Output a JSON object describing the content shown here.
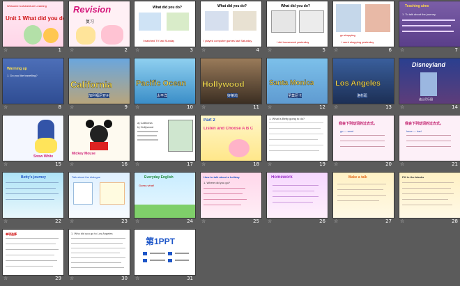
{
  "slide_icon": "star-icon",
  "slides": [
    {
      "num": "1",
      "text": "Unit 1 What did you do?",
      "sub": "Welcome to Adventure Learning"
    },
    {
      "num": "2",
      "text": "Revision",
      "sub": "复习"
    },
    {
      "num": "3",
      "text": "What did you do?",
      "sub": "I watched TV last Sunday"
    },
    {
      "num": "4",
      "text": "What did you do?",
      "sub": "I played computer games last Saturday"
    },
    {
      "num": "5",
      "text": "What did you do?",
      "sub": "I did housework yesterday"
    },
    {
      "num": "6",
      "text": "go shopping",
      "sub": "I went shopping yesterday"
    },
    {
      "num": "7",
      "text": "Teaching aims",
      "sub": "1. To talk about the journey"
    },
    {
      "num": "8",
      "text": "Warming up",
      "sub": "1. Do you like travelling?"
    },
    {
      "num": "9",
      "text": "California",
      "sub": "加利福尼亚州"
    },
    {
      "num": "10",
      "text": "Pacific Ocean",
      "sub": "太平洋"
    },
    {
      "num": "11",
      "text": "Hollywood",
      "sub": "好莱坞"
    },
    {
      "num": "12",
      "text": "Santa Monica",
      "sub": "圣莫尼卡"
    },
    {
      "num": "13",
      "text": "Los Angeles",
      "sub": "洛杉矶"
    },
    {
      "num": "14",
      "text": "Disneyland",
      "sub": "迪士尼乐园"
    },
    {
      "num": "15",
      "text": "Snow White",
      "sub": ""
    },
    {
      "num": "16",
      "text": "Mickey Mouse",
      "sub": ""
    },
    {
      "num": "17",
      "text": "a) California",
      "sub": "b) Hollywood"
    },
    {
      "num": "18",
      "text": "Part 2",
      "sub": "Listen and Choose A B C"
    },
    {
      "num": "19",
      "text": "1. What is Betty going to do?",
      "sub": ""
    },
    {
      "num": "20",
      "text": "我会下列动词的过去式。",
      "sub": "go — went"
    },
    {
      "num": "21",
      "text": "我会下列动词的过去式。",
      "sub": "have — had"
    },
    {
      "num": "22",
      "text": "Betty's journey",
      "sub": ""
    },
    {
      "num": "23",
      "text": "Talk about the dialogue",
      "sub": ""
    },
    {
      "num": "24",
      "text": "Everyday English",
      "sub": "Guess what!"
    },
    {
      "num": "25",
      "text": "How to talk about a holiday",
      "sub": "1. Where did you go?"
    },
    {
      "num": "26",
      "text": "Homework",
      "sub": ""
    },
    {
      "num": "27",
      "text": "Make a talk",
      "sub": ""
    },
    {
      "num": "28",
      "text": "Fill in the blanks",
      "sub": ""
    },
    {
      "num": "29",
      "text": "单项选择",
      "sub": ""
    },
    {
      "num": "30",
      "text": "1. Who did you go to Los Angeles",
      "sub": ""
    },
    {
      "num": "31",
      "text": "第1PPT",
      "sub": ""
    }
  ]
}
